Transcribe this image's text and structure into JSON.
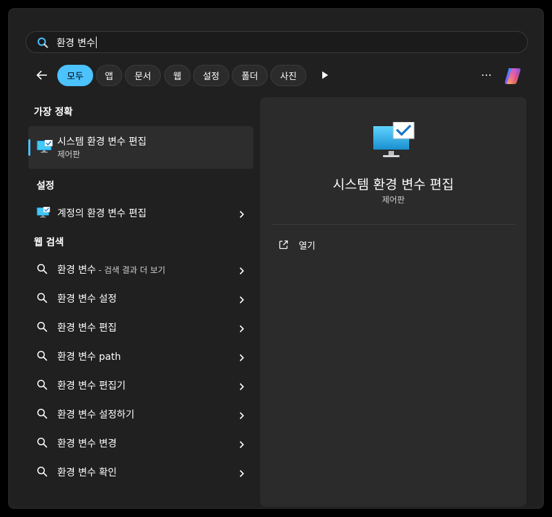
{
  "search": {
    "query": "환경 변수"
  },
  "filters": [
    "모두",
    "앱",
    "문서",
    "웹",
    "설정",
    "폴더",
    "사진"
  ],
  "sections": {
    "best_match": "가장 정확",
    "settings": "설정",
    "web_search": "웹 검색"
  },
  "best_match": {
    "title": "시스템 환경 변수 편집",
    "subtitle": "제어판"
  },
  "settings_item": {
    "label": "계정의 환경 변수 편집"
  },
  "web_results": [
    {
      "label": "환경 변수",
      "suffix": " - 검색 결과 더 보기"
    },
    {
      "label": "환경 변수 설정"
    },
    {
      "label": "환경 변수 편집"
    },
    {
      "label": "환경 변수 path"
    },
    {
      "label": "환경 변수 편집기"
    },
    {
      "label": "환경 변수 설정하기"
    },
    {
      "label": "환경 변수 변경"
    },
    {
      "label": "환경 변수 확인"
    }
  ],
  "preview": {
    "title": "시스템 환경 변수 편집",
    "subtitle": "제어판",
    "action_open": "열기"
  },
  "icons": {
    "search": "search-icon",
    "back": "arrow-left-icon",
    "more": "ellipsis-icon",
    "play": "play-icon",
    "copilot": "copilot-icon",
    "monitor": "monitor-check-icon",
    "chevron": "chevron-right-icon",
    "open": "open-external-icon"
  },
  "colors": {
    "accent": "#4cc2ff",
    "background": "#202020",
    "panel": "#2b2b2b"
  }
}
